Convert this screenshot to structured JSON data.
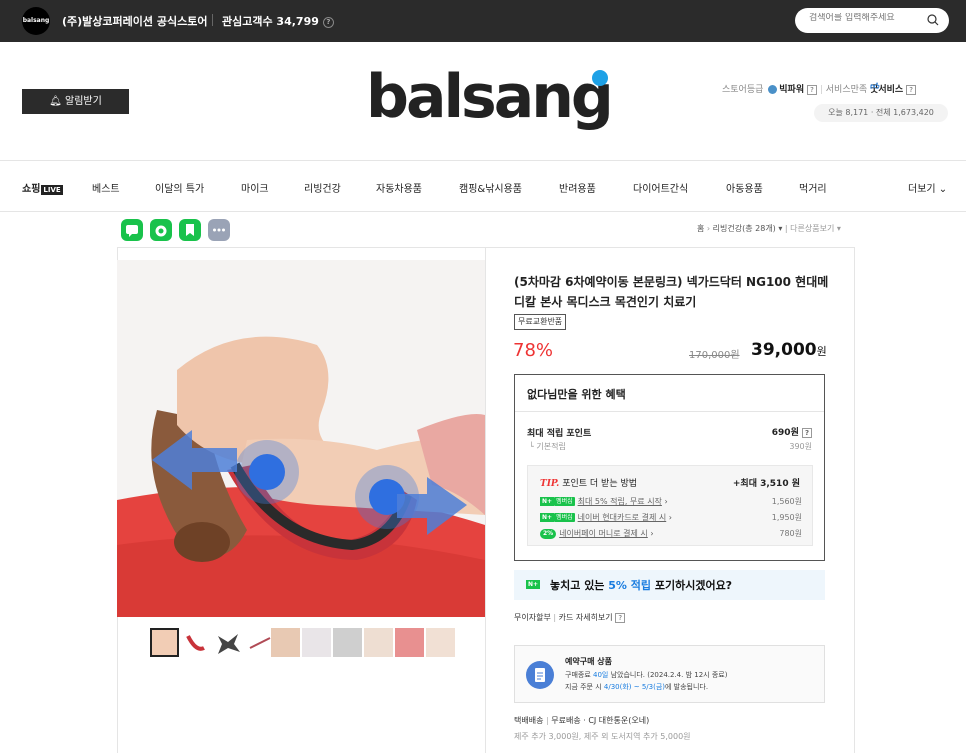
{
  "topbar": {
    "logo_text": "balsang",
    "store_name": "(주)발상코퍼레이션 공식스토어",
    "interest_label": "관심고객수 34,799",
    "help": "?",
    "search_placeholder": "검색어를 입력해주세요"
  },
  "header": {
    "alarm_label": "알림받기",
    "brand": "balsang",
    "store_grade_label": "스토어등급",
    "store_grade_value": "빅파워",
    "service_label": "서비스만족",
    "service_value": "굿서비스",
    "visitors": "오늘 8,171 · 전체 1,673,420"
  },
  "nav": {
    "items": [
      "쇼핑",
      "베스트",
      "이달의 특가",
      "마이크",
      "리빙건강",
      "자동차용품",
      "캠핑&낚시용품",
      "반려용품",
      "다이어트간식",
      "아동용품",
      "먹거리",
      "더보기 ⌄"
    ],
    "live_badge": "LIVE"
  },
  "breadcrumb": {
    "home": "홈",
    "category": "리빙건강(총 28개) ▾",
    "other": "다른상품보기 ▾"
  },
  "product": {
    "title": "(5차마감 6차예약이동 본문링크) 넥가드닥터 NG100 현대메디칼 본사 목디스크 목견인기 치료기",
    "tag": "무료교환반품",
    "discount": "78%",
    "original_price": "170,000원",
    "sale_price": "39,000",
    "sale_unit": "원"
  },
  "benefit": {
    "title": "없다님만을 위한 혜택",
    "max_point_label": "최대 적립 포인트",
    "max_point_value": "690원",
    "basic_label": "기본적립",
    "basic_value": "390원",
    "tip_label": "TIP.",
    "tip_text": "포인트 더 받는 방법",
    "tip_value": "+최대 3,510 원",
    "lines": [
      {
        "badge": "N+",
        "badge2": "멤버십",
        "text": "최대 5% 적립, 무료 시작",
        "value": "1,560원"
      },
      {
        "badge": "N+",
        "badge2": "멤버십",
        "text": "네이버 현대카드로 결제 시",
        "value": "1,950원"
      },
      {
        "badge": "2%",
        "text": "네이버페이 머니로 결제 시",
        "value": "780원"
      }
    ]
  },
  "banner": {
    "badge": "N+",
    "text_pre": "놓치고 있는 ",
    "text_highlight": "5% 적립",
    "text_post": " 포기하시겠어요?"
  },
  "installment": {
    "label": "무이자할부",
    "link": "카드 자세히보기"
  },
  "reserve": {
    "title": "예약구매 상품",
    "line1_pre": "구매종료 ",
    "line1_days": "40일",
    "line1_post": " 남았습니다. (2024.2.4. 밤 12시 종료)",
    "line2_pre": "지금 주문 시 ",
    "line2_dates": "4/30(화) ~ 5/3(금)",
    "line2_post": "에 발송됩니다."
  },
  "shipping": {
    "label": "택배배송",
    "free": "무료배송",
    "carrier": "· CJ 대한통운(오네)",
    "extra": "제주 추가 3,000원, 제주 외 도서지역 추가 5,000원"
  },
  "colors": {
    "accent_red": "#e33333",
    "naver_green": "#19c24b",
    "link_blue": "#1a7de0",
    "brand_dot": "#1ea1e6"
  }
}
